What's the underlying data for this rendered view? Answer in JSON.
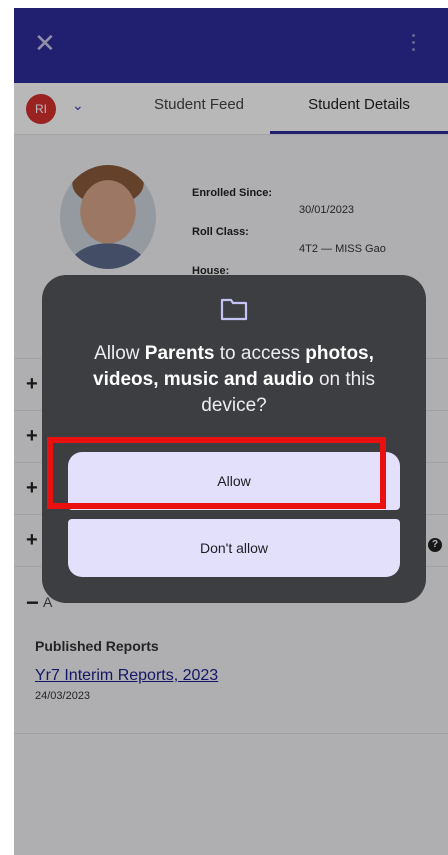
{
  "appbar": {
    "close_icon": "close-icon",
    "more_icon": "more-vert-icon",
    "bg_color": "#2e2b9c"
  },
  "tabs": {
    "avatar_initials": "RI",
    "tab1_label": "Student Feed",
    "tab2_label": "Student Details"
  },
  "details": {
    "enrolled_label": "Enrolled Since:",
    "enrolled_value": "30/01/2023",
    "roll_label": "Roll Class:",
    "roll_value": "4T2 — MISS Gao",
    "house_label": "House:"
  },
  "reports": {
    "section_title": "A",
    "published_heading": "Published Reports",
    "report_link": "Yr7 Interim Reports, 2023",
    "report_date": "24/03/2023"
  },
  "dialog": {
    "text_allow_prefix": "Allow ",
    "app_name": "Parents",
    "text_middle": " to access ",
    "media_types": "photos, videos, music and audio",
    "text_suffix": " on this device?",
    "allow_label": "Allow",
    "deny_label": "Don't allow",
    "icon": "folder-icon"
  }
}
